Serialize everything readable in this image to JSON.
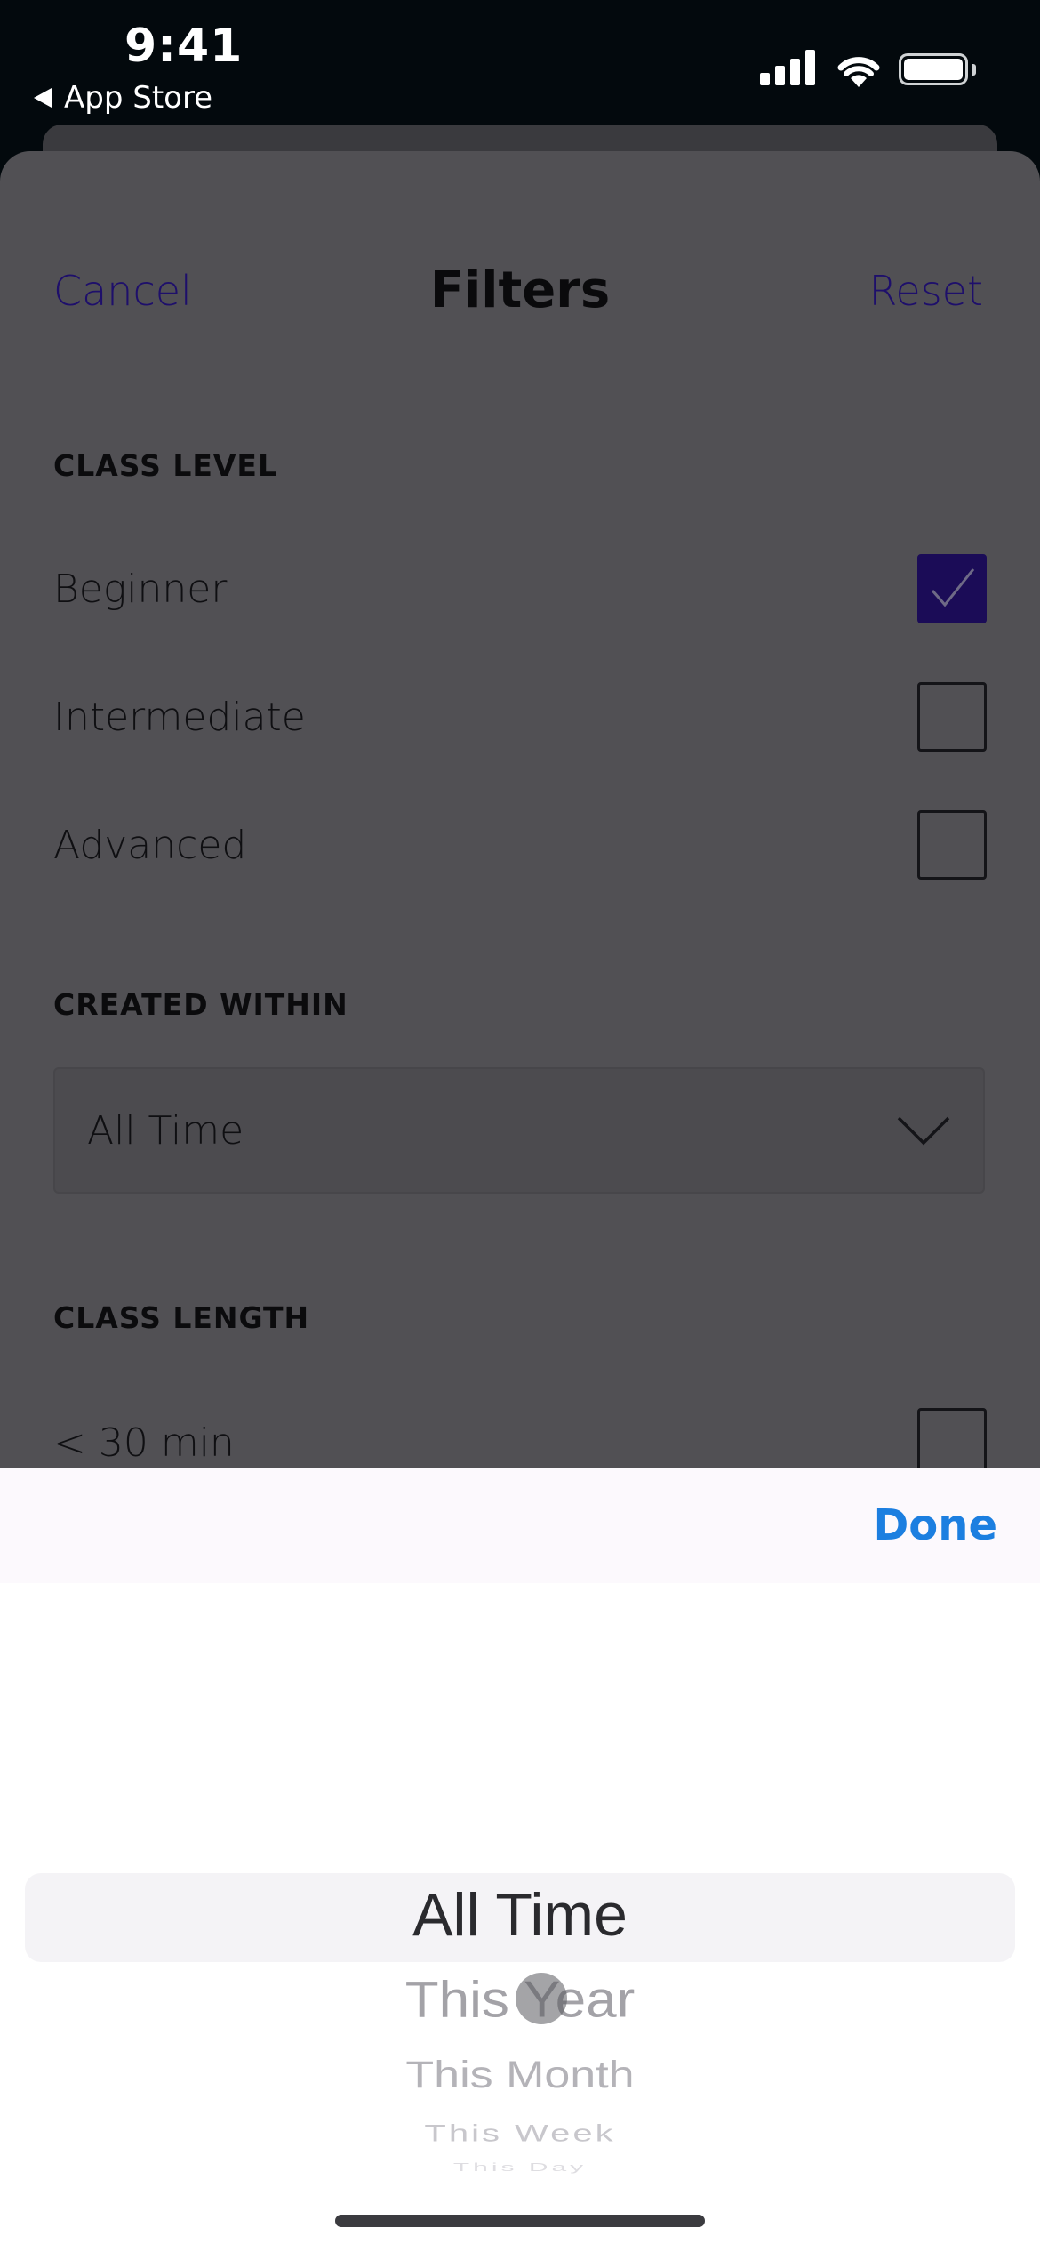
{
  "status_bar": {
    "time": "9:41",
    "back_label": "App Store",
    "back_icon": "back-triangle-icon",
    "signal_icon": "cellular-signal-icon",
    "wifi_icon": "wifi-icon",
    "battery_icon": "battery-icon"
  },
  "nav": {
    "cancel_label": "Cancel",
    "title": "Filters",
    "reset_label": "Reset",
    "link_color": "#1e0f6b"
  },
  "class_level": {
    "label": "CLASS LEVEL",
    "options": [
      {
        "label": "Beginner",
        "checked": true
      },
      {
        "label": "Intermediate",
        "checked": false
      },
      {
        "label": "Advanced",
        "checked": false
      }
    ]
  },
  "created_within": {
    "label": "CREATED WITHIN",
    "value": "All Time",
    "chevron_icon": "chevron-down-icon"
  },
  "class_length": {
    "label": "CLASS LENGTH",
    "options": [
      {
        "label": "< 30 min",
        "checked": false
      }
    ]
  },
  "picker": {
    "done_label": "Done",
    "done_color": "#1c7fe0",
    "selected": "All Time",
    "options": [
      "All Time",
      "This Year",
      "This Month",
      "This Week",
      "This Day"
    ]
  },
  "colors": {
    "checkbox_checked": "#1b0c57",
    "sheet_dimmed": "#515054"
  }
}
